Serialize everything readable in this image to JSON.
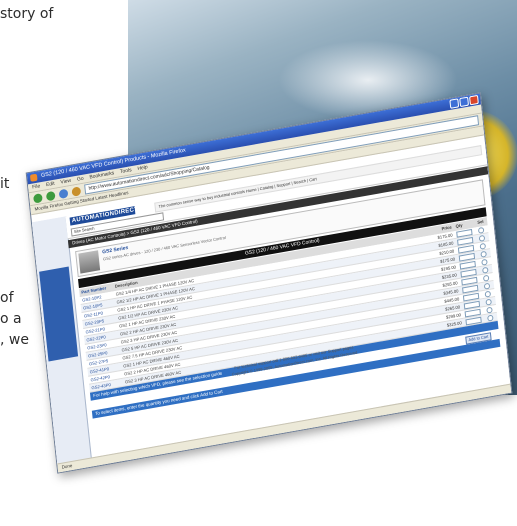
{
  "article": {
    "lines": [
      "story of",
      "it",
      "of",
      "o a",
      ", we"
    ]
  },
  "browser": {
    "window_title": "GS2 (120 / 460 VAC VFD Control) Products - Mozilla Firefox",
    "menu": [
      "File",
      "Edit",
      "View",
      "Go",
      "Bookmarks",
      "Tools",
      "Help"
    ],
    "address": "http://www.automationdirect.com/adc/Shopping/Catalog",
    "links_text": "Mozilla Firefox  Getting Started  Latest Headlines",
    "logo": "AUTOMATIONDIRECT",
    "top_nav_text": "The common sense way to buy industrial controls  Home | Catalog | Support | Search | Cart",
    "search_placeholder": "Site Search",
    "breadcrumb": "Drives (AC Motor Controls) > GS2 (120 / 460 VAC VFD Control)",
    "product_title": "GS2 Series",
    "product_desc": "GS2 series AC drives - 120 / 230 / 460 VAC Sensorless Vector Control",
    "table_header": "GS2 (120 / 460 VAC VFD Control)",
    "columns": [
      "Part Number",
      "Description",
      "Price",
      "Qty",
      "Sel"
    ],
    "rows": [
      {
        "part": "GS2-10P2",
        "desc": "GS2 1/4 HP AC DRIVE 1 PHASE 120V AC",
        "price": "$175.00"
      },
      {
        "part": "GS2-10P5",
        "desc": "GS2 1/2 HP AC DRIVE 1 PHASE 120V AC",
        "price": "$185.00"
      },
      {
        "part": "GS2-11P0",
        "desc": "GS2 1 HP AC DRIVE 1 PHASE 120V AC",
        "price": "$210.00"
      },
      {
        "part": "GS2-20P5",
        "desc": "GS2 1/2 HP AC DRIVE 230V AC",
        "price": "$175.00"
      },
      {
        "part": "GS2-21P0",
        "desc": "GS2 1 HP AC DRIVE 230V AC",
        "price": "$195.00"
      },
      {
        "part": "GS2-22P0",
        "desc": "GS2 2 HP AC DRIVE 230V AC",
        "price": "$235.00"
      },
      {
        "part": "GS2-23P0",
        "desc": "GS2 3 HP AC DRIVE 230V AC",
        "price": "$255.00"
      },
      {
        "part": "GS2-25P0",
        "desc": "GS2 5 HP AC DRIVE 230V AC",
        "price": "$345.00"
      },
      {
        "part": "GS2-27P5",
        "desc": "GS2 7.5 HP AC DRIVE 230V AC",
        "price": "$445.00"
      },
      {
        "part": "GS2-41P0",
        "desc": "GS2 1 HP AC DRIVE 460V AC",
        "price": "$265.00"
      },
      {
        "part": "GS2-42P0",
        "desc": "GS2 2 HP AC DRIVE 460V AC",
        "price": "$299.00"
      },
      {
        "part": "GS2-43P0",
        "desc": "GS2 3 HP AC DRIVE 460V AC",
        "price": "$325.00"
      }
    ],
    "blue_bar_1": "For help with selecting which VFD, please see the selection guide",
    "blue_bar_2": "To select items, enter the quantity you need and click Add to Cart",
    "add_to_cart": "Add to Cart",
    "footer_lines": [
      "For technical support call 1-800-633-0405 or visit our Support pages",
      "Copyright © 1999-2005, AutomationDirect.com, Inc. All Rights Reserved"
    ],
    "status": "Done"
  },
  "colors": {
    "titlebar": "#2a4fb0",
    "brand": "#1e4a99",
    "accent_bar": "#2f6fc3"
  }
}
